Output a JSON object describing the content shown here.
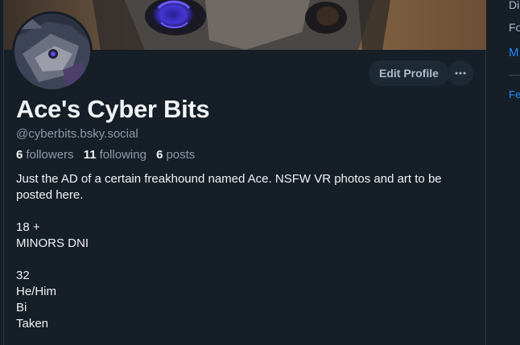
{
  "profile": {
    "display_name": "Ace's Cyber Bits",
    "handle": "@cyberbits.bsky.social",
    "edit_profile_label": "Edit Profile",
    "more_label": "···",
    "stats": {
      "followers_count": "6",
      "followers_label": "followers",
      "following_count": "11",
      "following_label": "following",
      "posts_count": "6",
      "posts_label": "posts"
    },
    "bio": [
      "Just the AD of a certain freakhound named Ace. NSFW VR photos and art to be",
      "posted here.",
      "",
      "18 +",
      "MINORS DNI",
      "",
      "32",
      "He/Him",
      "Bi",
      "Taken"
    ]
  },
  "sidebar": {
    "item_1": "Di",
    "item_2": "Fo",
    "item_3": "M",
    "item_4": "Fe"
  },
  "colors": {
    "background": "#161e27",
    "text_primary": "#f1f3f5",
    "text_muted": "#8d9aa7",
    "button_bg": "#1e2936",
    "link": "#208bfe"
  },
  "icons": {
    "more": "ellipsis-icon"
  }
}
